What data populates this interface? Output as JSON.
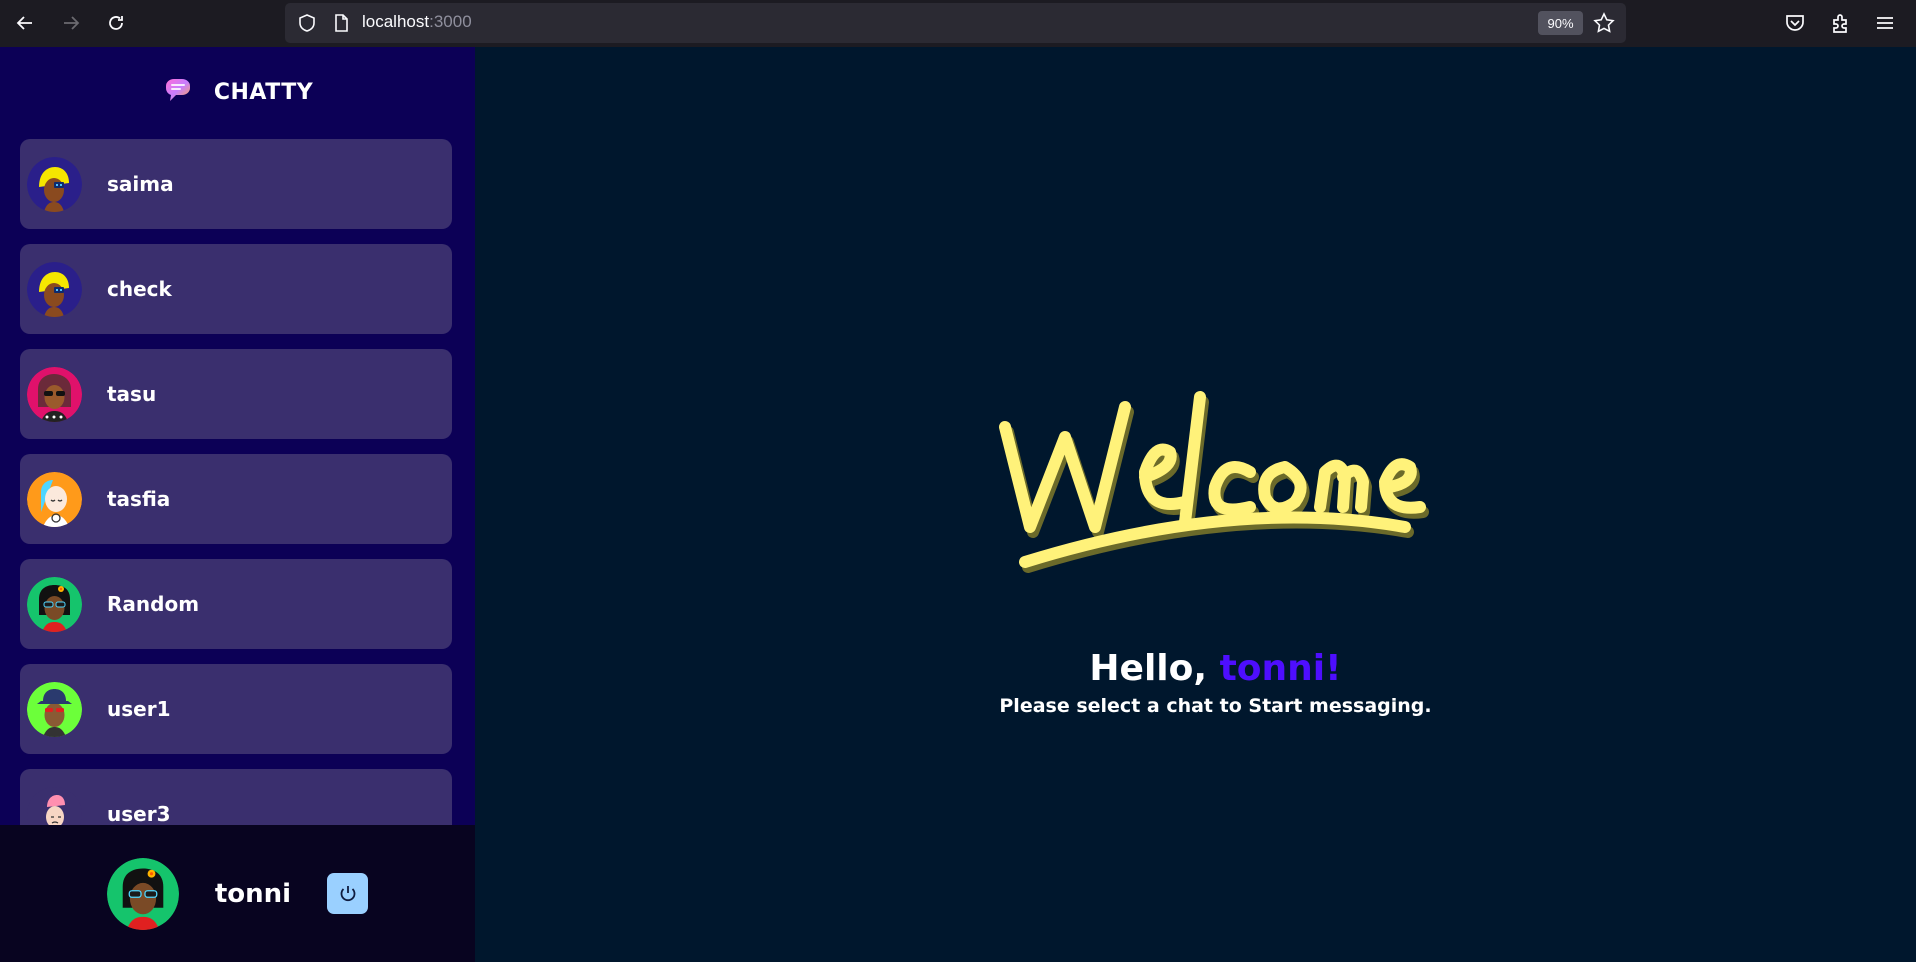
{
  "browser": {
    "url_host": "localhost",
    "url_port": ":3000",
    "zoom": "90%"
  },
  "app": {
    "brand_name": "CHATTY",
    "contacts": [
      {
        "name": "saima",
        "avatar": "avatar-yellow-hair"
      },
      {
        "name": "check",
        "avatar": "avatar-yellow-hair"
      },
      {
        "name": "tasu",
        "avatar": "avatar-pink-sunglasses"
      },
      {
        "name": "tasfia",
        "avatar": "avatar-orange-bald"
      },
      {
        "name": "Random",
        "avatar": "avatar-green-flower"
      },
      {
        "name": "user1",
        "avatar": "avatar-green-hat"
      },
      {
        "name": "user3",
        "avatar": "avatar-pink-hair"
      }
    ],
    "current_user": {
      "name": "tonni",
      "avatar": "avatar-green-flower"
    }
  },
  "welcome": {
    "image_text": "Welcome",
    "hello_prefix": "Hello, ",
    "username": "tonni!",
    "subtext": "Please select a chat to Start messaging."
  },
  "colors": {
    "sidebar_bg": "#0c0056",
    "contact_bg": "#3a2f6e",
    "main_bg": "#00172d",
    "accent": "#4e0eff",
    "logout_bg": "#9ad0ff",
    "welcome_yellow": "#fff27a"
  }
}
